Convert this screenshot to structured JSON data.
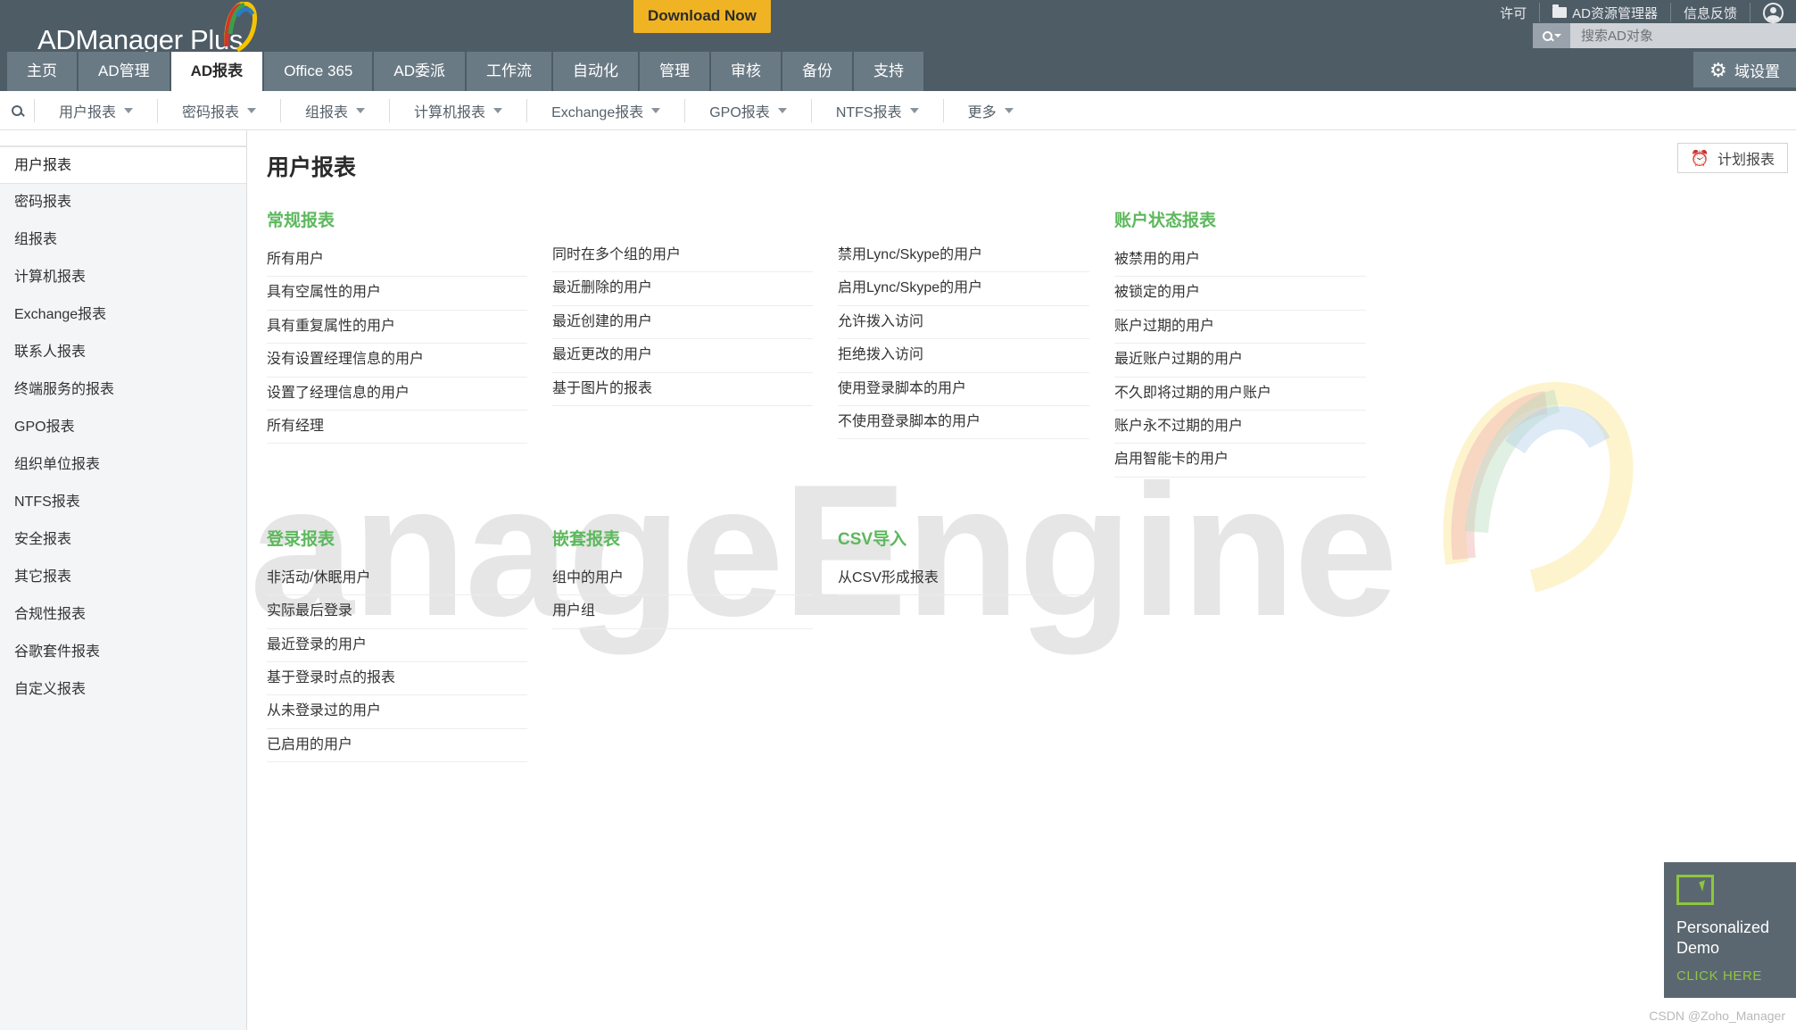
{
  "header": {
    "logo_text": "ADManager Plus",
    "download_label": "Download Now",
    "links": [
      {
        "label": "许可",
        "icon": ""
      },
      {
        "label": "AD资源管理器",
        "icon": "folder-icon"
      },
      {
        "label": "信息反馈",
        "icon": ""
      }
    ],
    "account_icon": "user-account-icon",
    "search": {
      "placeholder": "搜索AD对象",
      "value": "",
      "icon": "search-icon"
    },
    "domain_settings_label": "域设置",
    "domain_settings_icon": "gear-icon"
  },
  "tabs": [
    {
      "label": "主页",
      "active": false
    },
    {
      "label": "AD管理",
      "active": false
    },
    {
      "label": "AD报表",
      "active": true
    },
    {
      "label": "Office 365",
      "active": false
    },
    {
      "label": "AD委派",
      "active": false
    },
    {
      "label": "工作流",
      "active": false
    },
    {
      "label": "自动化",
      "active": false
    },
    {
      "label": "管理",
      "active": false
    },
    {
      "label": "审核",
      "active": false
    },
    {
      "label": "备份",
      "active": false
    },
    {
      "label": "支持",
      "active": false
    }
  ],
  "subnav": {
    "search_icon": "search-icon",
    "items": [
      {
        "label": "用户报表"
      },
      {
        "label": "密码报表"
      },
      {
        "label": "组报表"
      },
      {
        "label": "计算机报表"
      },
      {
        "label": "Exchange报表"
      },
      {
        "label": "GPO报表"
      },
      {
        "label": "NTFS报表"
      },
      {
        "label": "更多"
      }
    ]
  },
  "sidebar": {
    "items": [
      {
        "label": "用户报表",
        "active": true
      },
      {
        "label": "密码报表",
        "active": false
      },
      {
        "label": "组报表",
        "active": false
      },
      {
        "label": "计算机报表",
        "active": false
      },
      {
        "label": "Exchange报表",
        "active": false
      },
      {
        "label": "联系人报表",
        "active": false
      },
      {
        "label": "终端服务的报表",
        "active": false
      },
      {
        "label": "GPO报表",
        "active": false
      },
      {
        "label": "组织单位报表",
        "active": false
      },
      {
        "label": "NTFS报表",
        "active": false
      },
      {
        "label": "安全报表",
        "active": false
      },
      {
        "label": "其它报表",
        "active": false
      },
      {
        "label": "合规性报表",
        "active": false
      },
      {
        "label": "谷歌套件报表",
        "active": false
      },
      {
        "label": "自定义报表",
        "active": false
      }
    ]
  },
  "main": {
    "page_title": "用户报表",
    "schedule_button": {
      "label": "计划报表",
      "icon": "alarm-clock-icon"
    },
    "watermark_text": "ManageEngine",
    "row1": [
      {
        "title": "常规报表",
        "title_visible": true,
        "items": [
          "所有用户",
          "具有空属性的用户",
          "具有重复属性的用户",
          "没有设置经理信息的用户",
          "设置了经理信息的用户",
          "所有经理"
        ]
      },
      {
        "title": "",
        "title_visible": false,
        "items": [
          "同时在多个组的用户",
          "最近删除的用户",
          "最近创建的用户",
          "最近更改的用户",
          "基于图片的报表"
        ]
      },
      {
        "title": "",
        "title_visible": false,
        "items": [
          "禁用Lync/Skype的用户",
          "启用Lync/Skype的用户",
          "允许拨入访问",
          "拒绝拨入访问",
          "使用登录脚本的用户",
          "不使用登录脚本的用户"
        ]
      },
      {
        "title": "账户状态报表",
        "title_visible": true,
        "items": [
          "被禁用的用户",
          "被锁定的用户",
          "账户过期的用户",
          "最近账户过期的用户",
          "不久即将过期的用户账户",
          "账户永不过期的用户",
          "启用智能卡的用户"
        ]
      }
    ],
    "row2": [
      {
        "title": "登录报表",
        "title_visible": true,
        "items": [
          "非活动/休眠用户",
          "实际最后登录",
          "最近登录的用户",
          "基于登录时点的报表",
          "从未登录过的用户",
          "已启用的用户"
        ]
      },
      {
        "title": "嵌套报表",
        "title_visible": true,
        "items": [
          "组中的用户",
          "用户组"
        ]
      },
      {
        "title": "CSV导入",
        "title_visible": true,
        "items": [
          "从CSV形成报表"
        ]
      },
      {
        "title": "",
        "title_visible": false,
        "items": []
      }
    ]
  },
  "demo_widget": {
    "title": "Personalized\nDemo",
    "cta": "CLICK HERE",
    "icon": "screen-cursor-icon",
    "accent_color": "#8dc63f"
  },
  "credit": "CSDN @Zoho_Manager",
  "colors": {
    "header_bg": "#4e5c66",
    "tab_bg": "#6a7a85",
    "accent_green": "#5cb85c",
    "download_yellow": "#f0b323",
    "sidebar_bg": "#f4f5f6"
  }
}
